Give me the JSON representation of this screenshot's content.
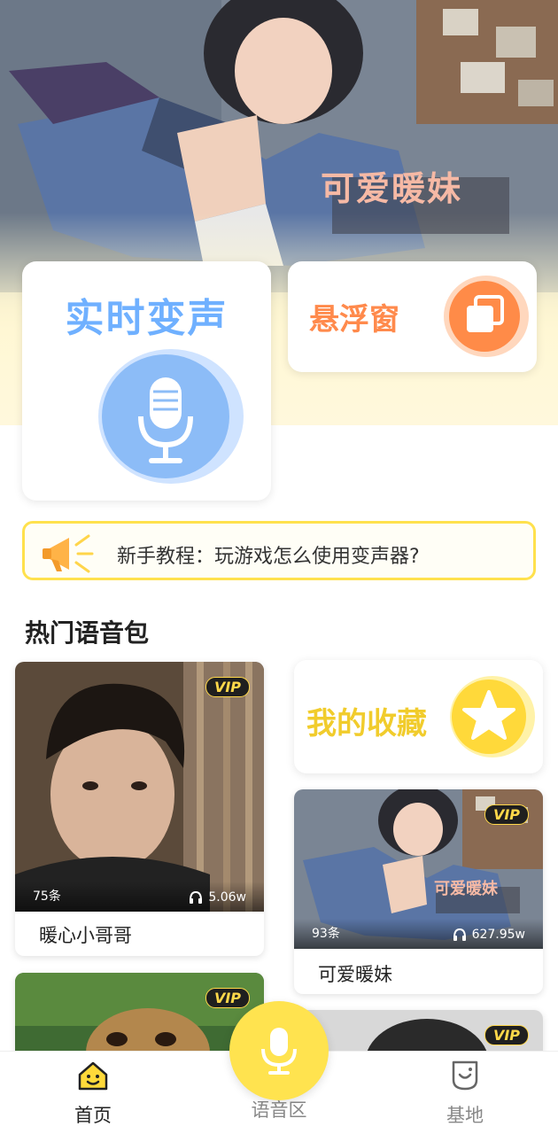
{
  "hero": {
    "caption": "可爱暖妹"
  },
  "realtime": {
    "title": "实时变声",
    "icon": "microphone-icon",
    "color": "#6fb0ff"
  },
  "floating_window": {
    "title": "悬浮窗",
    "icon": "window-stack-icon",
    "color": "#ff8a4c"
  },
  "tutorial": {
    "icon": "megaphone-icon",
    "text": "新手教程：玩游戏怎么使用变声器?"
  },
  "section": {
    "title": "热门语音包"
  },
  "favorites": {
    "title": "我的收藏",
    "icon": "star-icon",
    "color": "#f1cc2c"
  },
  "voice_packs": [
    {
      "name": "暖心小哥哥",
      "vip": "VIP",
      "count": "75条",
      "plays": "5.06w"
    },
    {
      "name": "可爱暖妹",
      "vip": "VIP",
      "count": "93条",
      "plays": "627.95w",
      "caption": "可爱暖妹"
    },
    {
      "vip": "VIP"
    },
    {
      "vip": "VIP"
    }
  ],
  "bottom_nav": {
    "home": {
      "label": "首页",
      "icon": "home-smile-icon"
    },
    "voice": {
      "label": "语音区",
      "icon": "microphone-icon"
    },
    "base": {
      "label": "基地",
      "icon": "base-icon"
    }
  },
  "colors": {
    "accent_yellow": "#ffe34f",
    "vip_bg": "#1f1f1f",
    "vip_text": "#ffd84a"
  }
}
